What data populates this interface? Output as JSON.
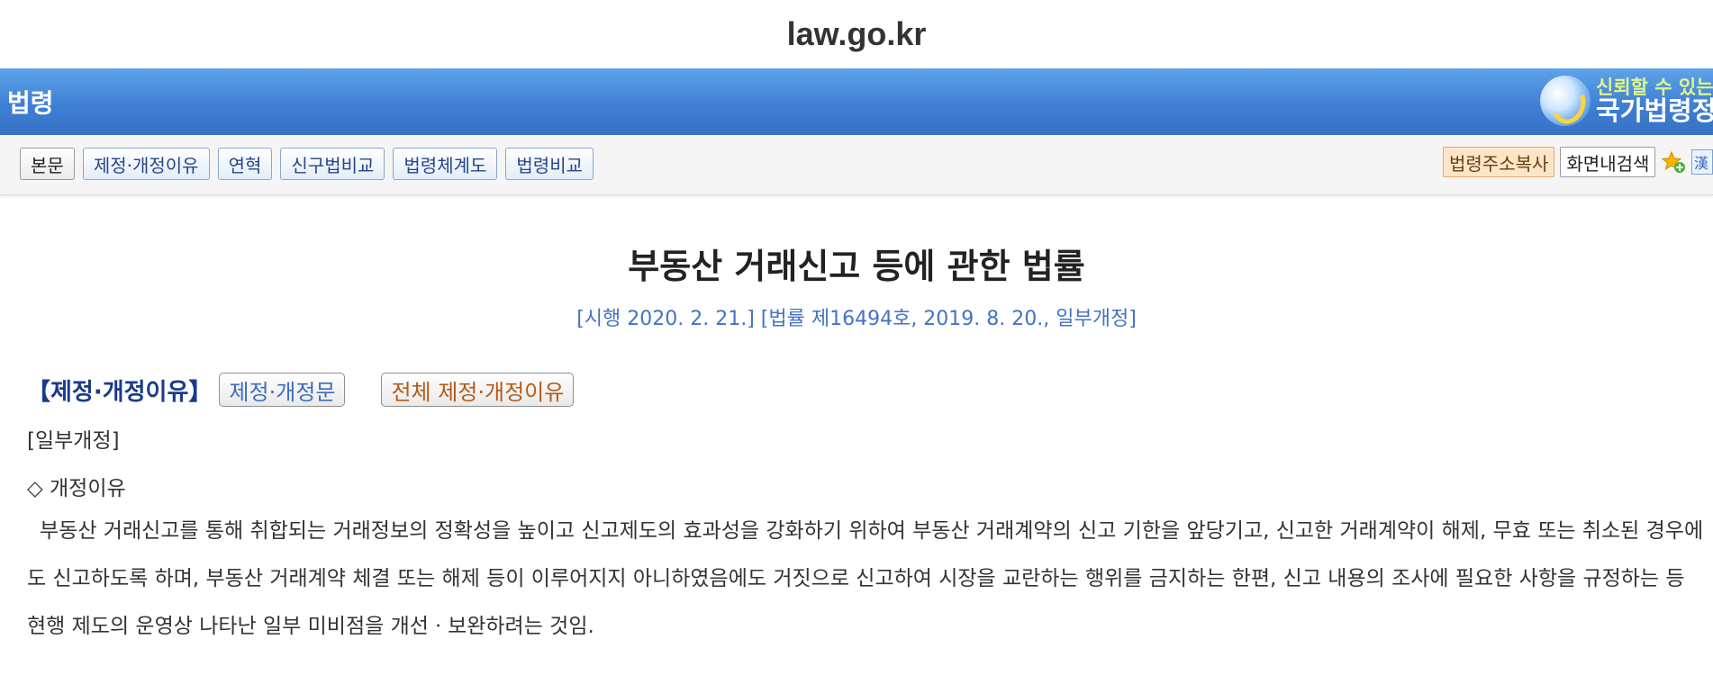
{
  "browser": {
    "url": "law.go.kr"
  },
  "header": {
    "title": "법령",
    "logo_sub": "신뢰할 수 있는",
    "logo_main": "국가법령정"
  },
  "toolbar": {
    "tabs": [
      {
        "label": "본문"
      },
      {
        "label": "제정·개정이유"
      },
      {
        "label": "연혁"
      },
      {
        "label": "신구법비교"
      },
      {
        "label": "법령체계도"
      },
      {
        "label": "법령비교"
      }
    ],
    "copy_address_label": "법령주소복사",
    "in_page_search_label": "화면내검색",
    "extra_icon_glyph": "漢"
  },
  "law": {
    "title": "부동산 거래신고 등에 관한 법률",
    "meta": "[시행 2020. 2. 21.] [법률 제16494호, 2019. 8. 20., 일부개정]"
  },
  "reason": {
    "heading": "【제정·개정이유】",
    "revision_text_button": "제정·개정문",
    "all_reasons_button": "전체 제정·개정이유",
    "type": "[일부개정]",
    "subheading": "◇ 개정이유",
    "paragraph": "부동산 거래신고를 통해 취합되는 거래정보의 정확성을 높이고 신고제도의 효과성을 강화하기 위하여 부동산 거래계약의 신고 기한을 앞당기고, 신고한 거래계약이 해제, 무효 또는 취소된 경우에도 신고하도록 하며, 부동산 거래계약 체결 또는 해제 등이 이루어지지 아니하였음에도 거짓으로 신고하여 시장을 교란하는 행위를 금지하는 한편, 신고 내용의 조사에 필요한 사항을 규정하는 등 현행 제도의 운영상 나타난 일부 미비점을 개선ㆍ보완하려는 것임."
  },
  "colors": {
    "header_blue": "#3f7fd3",
    "tab_text": "#24478a",
    "meta_blue": "#4472c4",
    "heading_navy": "#1b3a8c",
    "orange_button_text": "#b55a16"
  },
  "icons": {
    "logo": "national-law-logo-icon",
    "favorite": "star-plus-icon",
    "hanja": "hanja-icon"
  }
}
